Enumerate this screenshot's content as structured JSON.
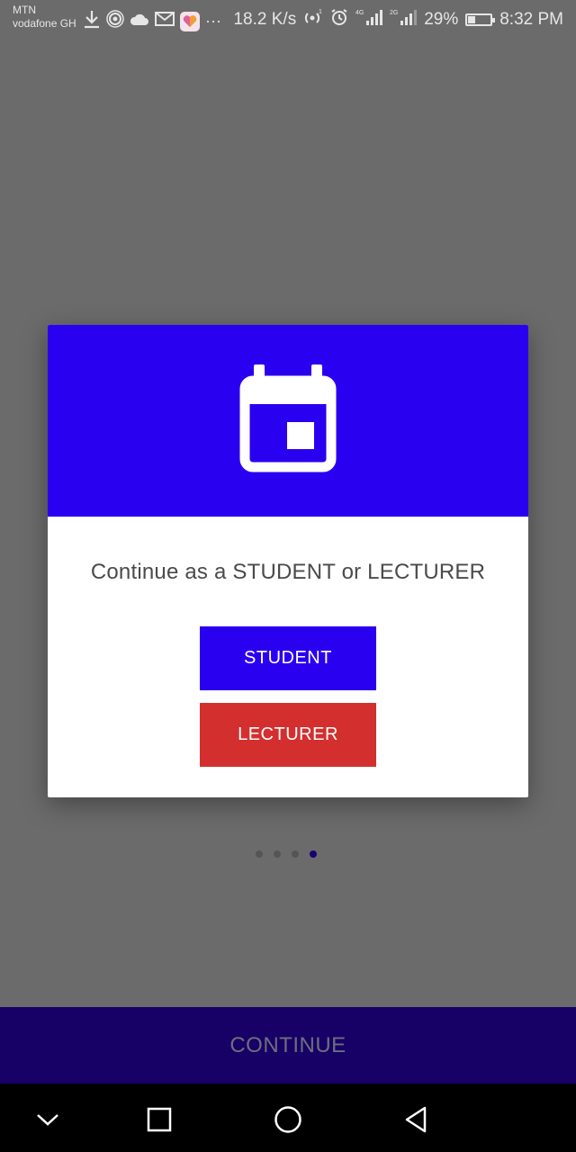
{
  "status_bar": {
    "carrier_1": "MTN",
    "carrier_2": "vodafone GH",
    "net_speed": "18.2 K/s",
    "battery": "29%",
    "battery_level": 0.29,
    "time": "8:32 PM",
    "network_1": "4G",
    "network_2": "2G",
    "ellipsis": "···"
  },
  "dialog": {
    "header_icon": "calendar-icon",
    "prompt": "Continue as a STUDENT or LECTURER",
    "student_label": "STUDENT",
    "lecturer_label": "LECTURER"
  },
  "pager": {
    "total": 4,
    "current": 4
  },
  "continue_label": "CONTINUE",
  "nav_bar": {
    "icons": [
      "chevron-down-icon",
      "recents-icon",
      "home-icon",
      "back-icon"
    ]
  },
  "colors": {
    "primary": "#2a00f0",
    "lecturer": "#d32f2f",
    "continue_bar": "#170066",
    "scrim": "#6b6b6b"
  }
}
